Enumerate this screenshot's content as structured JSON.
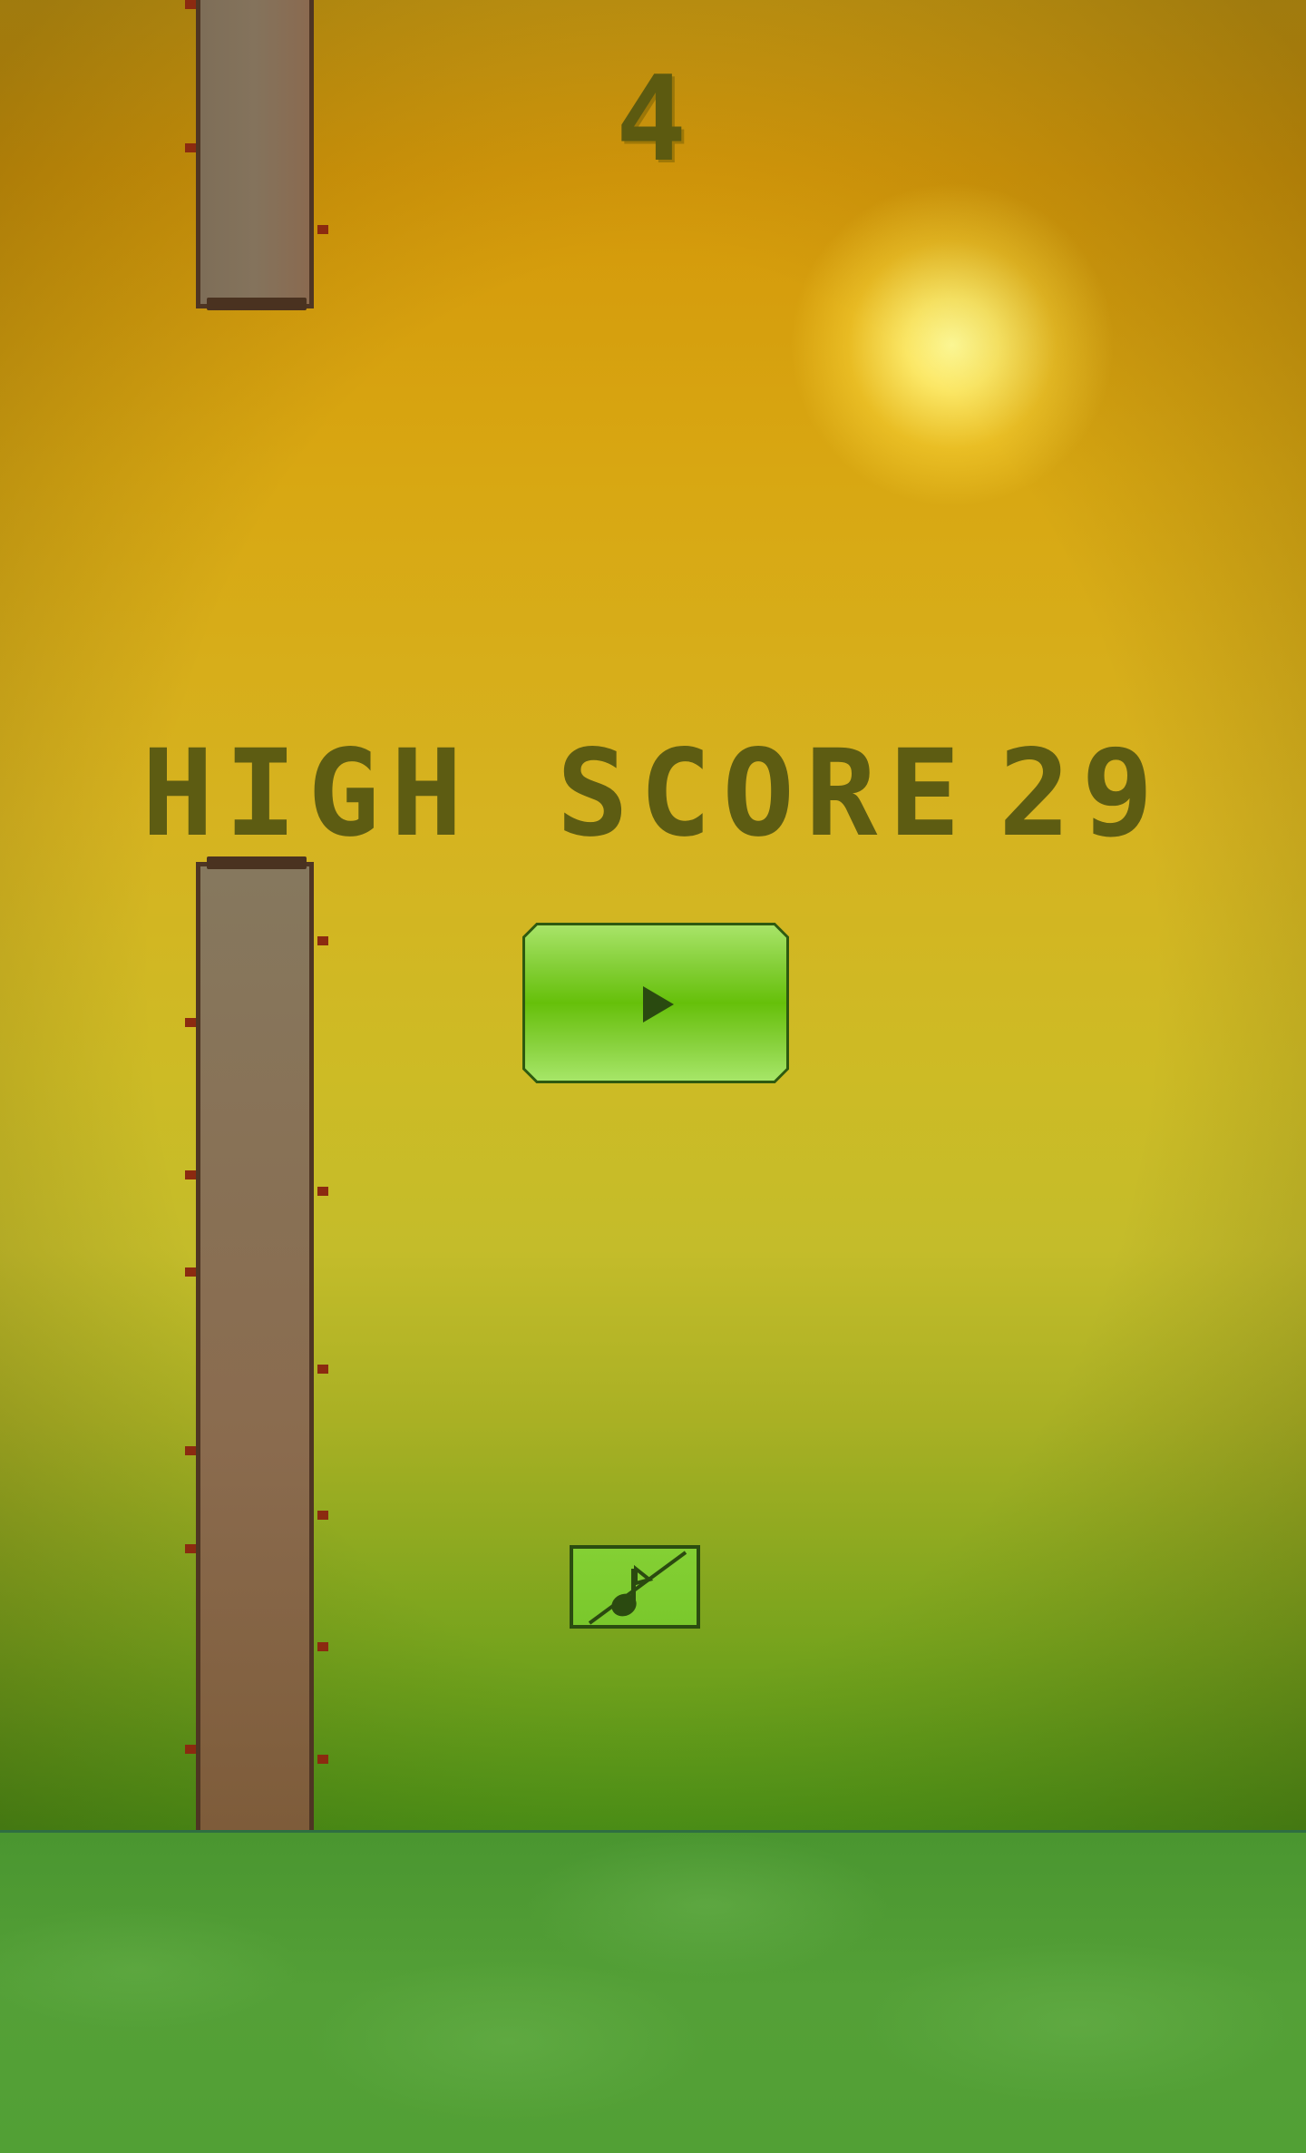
{
  "game": {
    "score": "4",
    "high_score_label": "HIGH SCORE",
    "high_score_value": "29"
  },
  "buttons": {
    "play_icon": "play-icon",
    "sound_icon": "muted-sound-icon"
  },
  "colors": {
    "sky_top": "#d4980a",
    "sky_bottom": "#2a8412",
    "text": "#5d5c12",
    "pipe": "#857659",
    "play_button": "#66c00a",
    "ground": "#52a035"
  }
}
